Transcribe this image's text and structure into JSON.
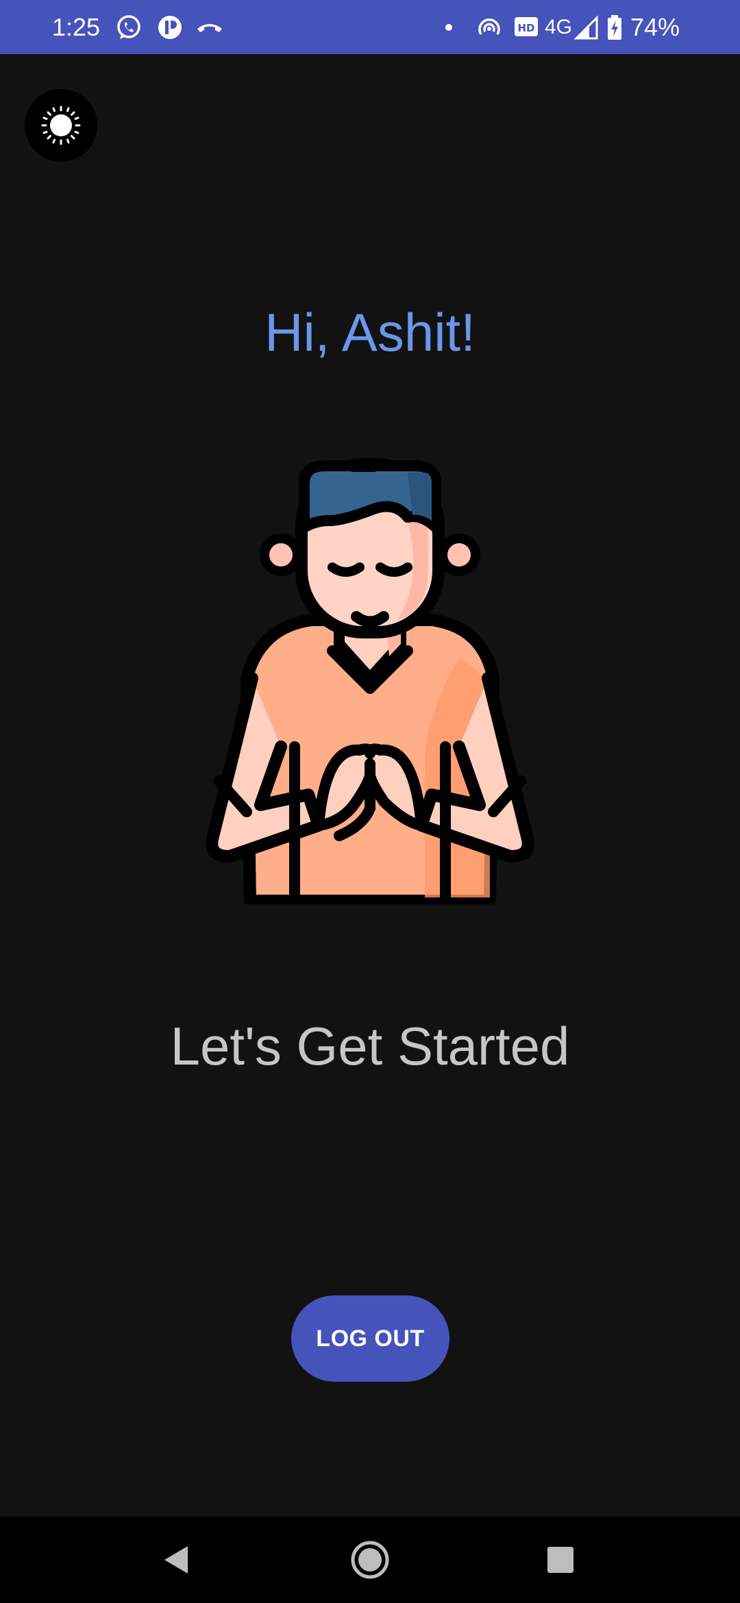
{
  "status_bar": {
    "time": "1:25",
    "network": "4G",
    "battery": "74%",
    "icons": [
      "whatsapp-icon",
      "app-notification-icon",
      "missed-call-icon",
      "dot-icon",
      "hotspot-icon",
      "hd-icon",
      "signal-icon",
      "battery-charging-icon"
    ],
    "background_color": "#4553bb"
  },
  "theme_toggle": {
    "icon": "sun-icon"
  },
  "greeting": "Hi, Ashit!",
  "illustration": {
    "icon": "namaste-person-illustration"
  },
  "subtitle": "Let's Get Started",
  "logout_button": {
    "label": "LOG OUT"
  },
  "nav_bar": {
    "buttons": [
      "back-icon",
      "home-icon",
      "recents-icon"
    ]
  },
  "colors": {
    "accent": "#4553bb",
    "greeting": "#6b96ea",
    "background": "#121212",
    "subtitle": "#c6c6c6"
  }
}
